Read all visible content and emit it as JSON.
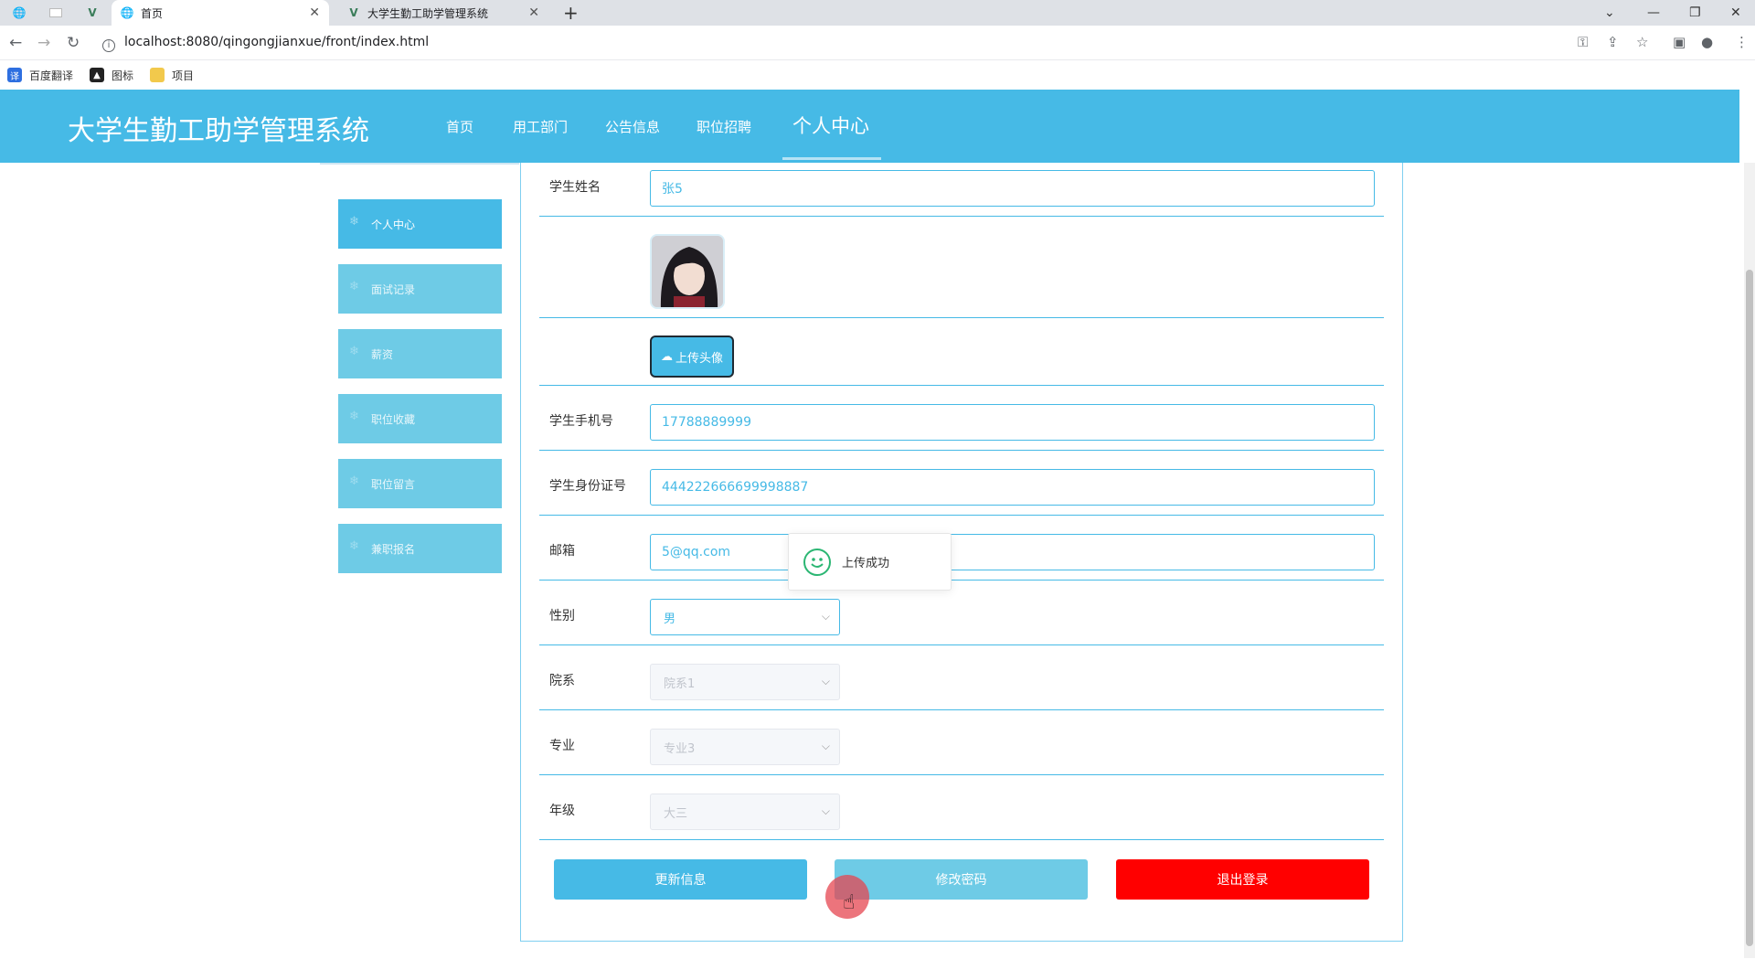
{
  "browser": {
    "tabs": [
      {
        "title": "首页",
        "active": true
      },
      {
        "title": "大学生勤工助学管理系统",
        "active": false
      }
    ],
    "url": "localhost:8080/qingongjianxue/front/index.html",
    "bookmarks": [
      "百度翻译",
      "图标",
      "项目"
    ]
  },
  "site": {
    "title": "大学生勤工助学管理系统",
    "nav": [
      "首页",
      "用工部门",
      "公告信息",
      "职位招聘",
      "个人中心"
    ],
    "active_nav": "个人中心"
  },
  "sidebar": {
    "items": [
      {
        "label": "个人中心",
        "active": true
      },
      {
        "label": "面试记录",
        "active": false
      },
      {
        "label": "薪资",
        "active": false
      },
      {
        "label": "职位收藏",
        "active": false
      },
      {
        "label": "职位留言",
        "active": false
      },
      {
        "label": "兼职报名",
        "active": false
      }
    ]
  },
  "form": {
    "student_name_label": "学生姓名",
    "student_name": "张5",
    "upload_avatar_label": "上传头像",
    "phone_label": "学生手机号",
    "phone": "17788889999",
    "id_card_label": "学生身份证号",
    "id_card": "444222666699998887",
    "email_label": "邮箱",
    "email": "5@qq.com",
    "gender_label": "性别",
    "gender": "男",
    "department_label": "院系",
    "department": "院系1",
    "major_label": "专业",
    "major": "专业3",
    "grade_label": "年级",
    "grade": "大三"
  },
  "actions": {
    "update": "更新信息",
    "change_password": "修改密码",
    "logout": "退出登录"
  },
  "toast": {
    "message": "上传成功"
  },
  "colors": {
    "primary": "#46bae6",
    "secondary": "#6ecbe6",
    "danger": "#ff0000",
    "success": "#2bb673"
  }
}
